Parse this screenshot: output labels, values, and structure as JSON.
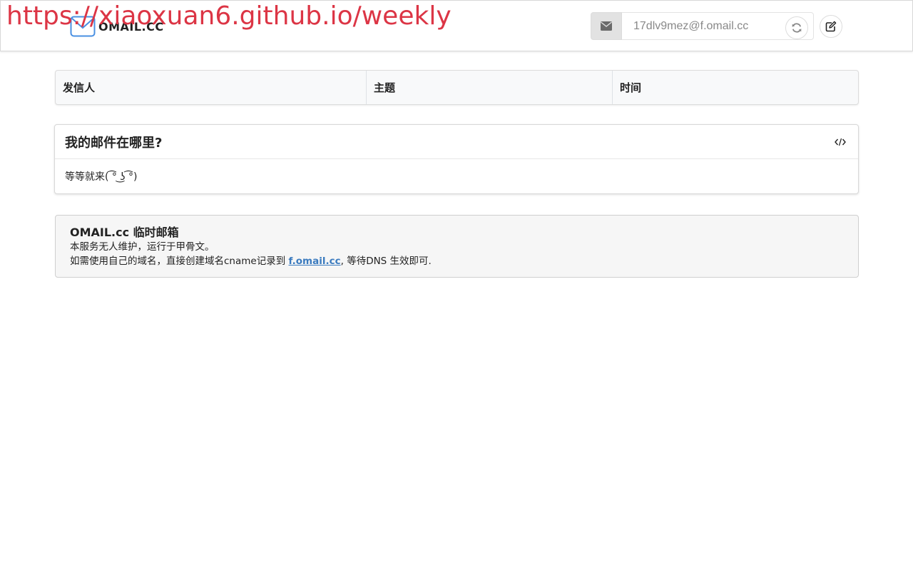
{
  "header": {
    "logo_text": "OMAIL.CC",
    "watermark": "https://xiaoxuan6.github.io/weekly",
    "email_value": "17dlv9mez@f.omail.cc",
    "mail_icon": "envelope-icon",
    "refresh_icon": "refresh-icon",
    "edit_icon": "edit-icon"
  },
  "table": {
    "columns": [
      "发信人",
      "主题",
      "时间"
    ]
  },
  "message": {
    "title": "我的邮件在哪里?",
    "body": "等等就来( ͡° ͜ʖ ͡°)",
    "code_icon": "code-icon"
  },
  "info": {
    "title": "OMAIL.cc 临时邮箱",
    "line1": "本服务无人维护，运行于甲骨文。",
    "line2_prefix": "如需使用自己的域名，直接创建域名cname记录到 ",
    "line2_link": "f.omail.cc",
    "line2_suffix": ", 等待DNS 生效即可."
  },
  "colors": {
    "watermark": "#dc3545",
    "link": "#3b7bbf",
    "logo_blue": "#4a90e2"
  }
}
